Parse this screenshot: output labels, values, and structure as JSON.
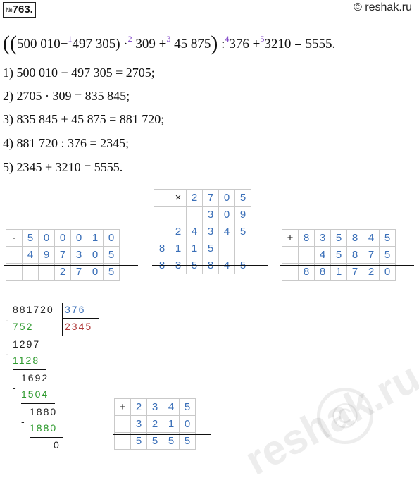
{
  "header": {
    "number_prefix": "№",
    "number": "763.",
    "watermark": "© reshak.ru"
  },
  "expression": {
    "open_parens": "((",
    "a": "500 010",
    "op1": "−",
    "o1": "1",
    "b": "497 305",
    "close1": ")",
    "op2": "·",
    "o2": "2",
    "c": "309",
    "op3": "+",
    "o3": "3",
    "d": "45 875",
    "close2": ")",
    "op4": ":",
    "o4": "4",
    "e": "376",
    "op5": "+",
    "o5": "5",
    "f": "3210",
    "eq": "=",
    "result": "5555."
  },
  "steps": [
    "1) 500 010 − 497 305 = 2705;",
    "2) 2705 · 309 = 835 845;",
    "3) 835 845 + 45 875 = 881 720;",
    "4) 881 720 : 376 = 2345;",
    "5) 2345 + 3210 = 5555."
  ],
  "subtraction": {
    "sign": "-",
    "row1": [
      "",
      "5",
      "0",
      "0",
      "0",
      "1",
      "0"
    ],
    "row2": [
      "",
      "4",
      "9",
      "7",
      "3",
      "0",
      "5"
    ],
    "row3": [
      "",
      "",
      "",
      "2",
      "7",
      "0",
      "5"
    ]
  },
  "multiplication": {
    "sign": "×",
    "row1": [
      "",
      "",
      "2",
      "7",
      "0",
      "5"
    ],
    "row2": [
      "",
      "",
      "",
      "3",
      "0",
      "9"
    ],
    "row3": [
      "",
      "2",
      "4",
      "3",
      "4",
      "5"
    ],
    "row4": [
      "8",
      "1",
      "1",
      "5",
      "",
      ""
    ],
    "row5": [
      "8",
      "3",
      "5",
      "8",
      "4",
      "5"
    ]
  },
  "addition1": {
    "sign": "+",
    "row1": [
      "",
      "8",
      "3",
      "5",
      "8",
      "4",
      "5"
    ],
    "row2": [
      "",
      "",
      "4",
      "5",
      "8",
      "7",
      "5"
    ],
    "row3": [
      "",
      "8",
      "8",
      "1",
      "7",
      "2",
      "0"
    ]
  },
  "division": {
    "dividend": "881720",
    "divisor": "376",
    "quotient": "2345",
    "m1": "-",
    "s1": "752",
    "r1": "1297",
    "m2": "-",
    "s2": "1128",
    "r2": "1692",
    "m3": "-",
    "s3": "1504",
    "r3": "1880",
    "m4": "-",
    "s4": "1880",
    "r4": "0"
  },
  "addition2": {
    "sign": "+",
    "row1": [
      "",
      "2",
      "3",
      "4",
      "5"
    ],
    "row2": [
      "",
      "3",
      "2",
      "1",
      "0"
    ],
    "row3": [
      "",
      "5",
      "5",
      "5",
      "5"
    ]
  },
  "watermark_big": "reshak.ru",
  "watermark_circle": "©"
}
